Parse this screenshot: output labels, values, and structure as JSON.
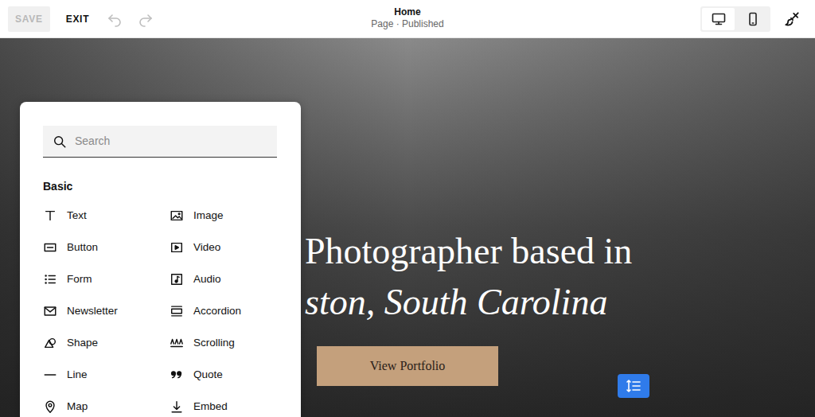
{
  "toolbar": {
    "save": {
      "label": "SAVE",
      "disabled": true
    },
    "exit": {
      "label": "EXIT"
    },
    "undo": {
      "disabled": true
    },
    "redo": {
      "disabled": true
    }
  },
  "page": {
    "title": "Home",
    "status": "Page · Published"
  },
  "devices": [
    {
      "selected": true
    },
    {
      "selected": false
    }
  ],
  "hero": {
    "lines": [
      "Photographer based in",
      "ston, South Carolina"
    ],
    "button": "View Portfolio"
  },
  "panel": {
    "search": {
      "placeholder": "Search"
    },
    "sections": [
      {
        "title": "Basic",
        "items": [
          {
            "label": "Text"
          },
          {
            "label": "Image"
          },
          {
            "label": "Button"
          },
          {
            "label": "Video"
          },
          {
            "label": "Form"
          },
          {
            "label": "Audio"
          },
          {
            "label": "Newsletter"
          },
          {
            "label": "Accordion"
          },
          {
            "label": "Shape"
          },
          {
            "label": "Scrolling"
          },
          {
            "label": "Line"
          },
          {
            "label": "Quote"
          },
          {
            "label": "Map"
          },
          {
            "label": "Embed"
          }
        ]
      }
    ]
  }
}
